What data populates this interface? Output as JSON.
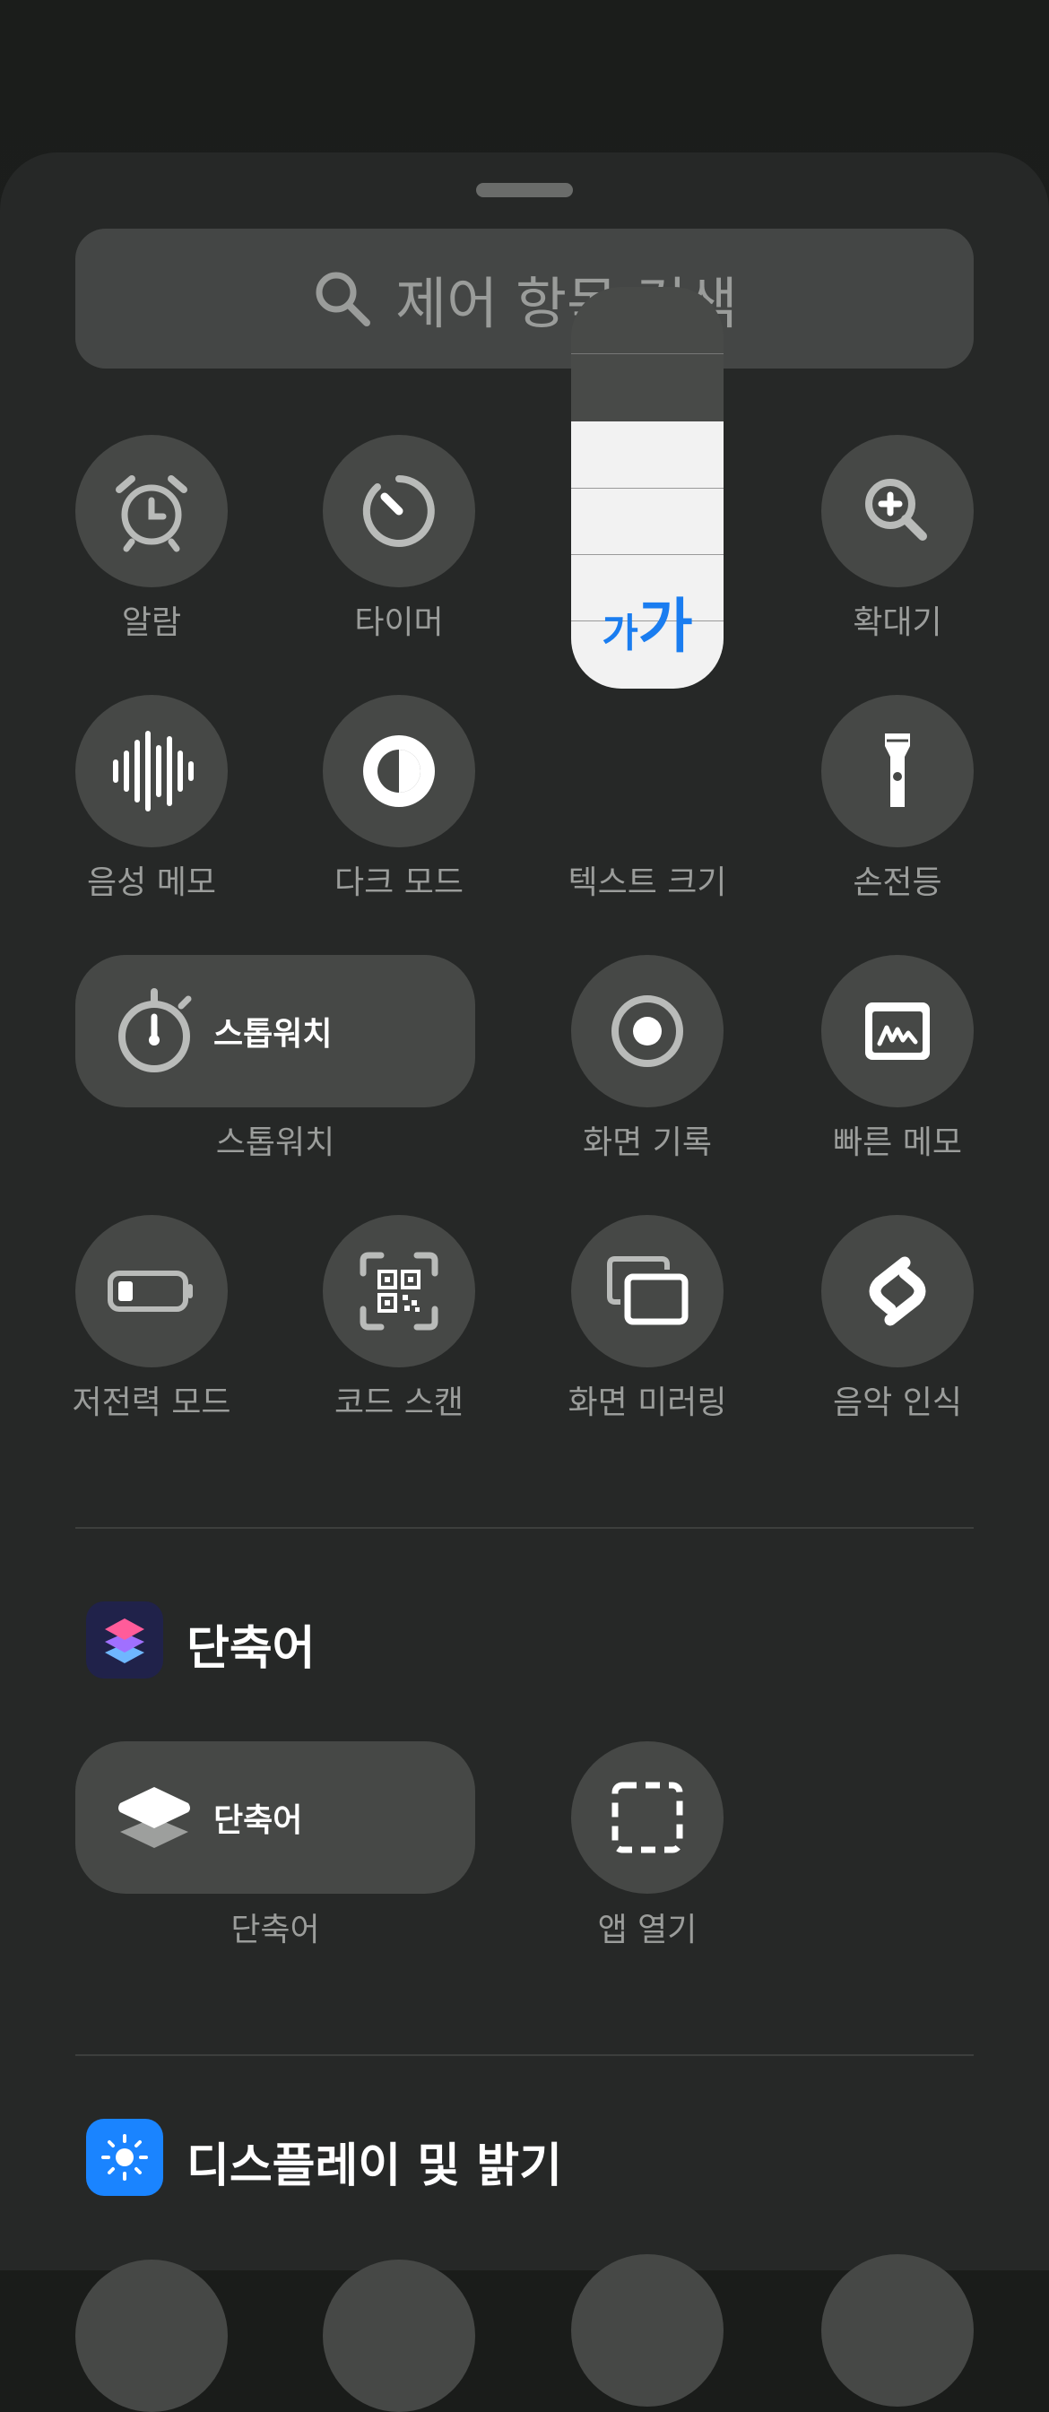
{
  "search": {
    "placeholder": "제어 항목 검색",
    "icon": "search-icon"
  },
  "controls": {
    "alarm": {
      "label": "알람",
      "icon": "alarm-clock-icon"
    },
    "timer": {
      "label": "타이머",
      "icon": "timer-icon"
    },
    "text_size": {
      "label": "텍스트 크기",
      "glyph_small": "가",
      "glyph_big": "가",
      "level_fraction": 0.66,
      "accent": "#1a7df0"
    },
    "magnifier": {
      "label": "확대기",
      "icon": "magnifier-icon"
    },
    "voice_memo": {
      "label": "음성 메모",
      "icon": "waveform-icon"
    },
    "dark_mode": {
      "label": "다크 모드",
      "icon": "dark-mode-icon"
    },
    "flashlight": {
      "label": "손전등",
      "icon": "flashlight-icon"
    },
    "stopwatch": {
      "label": "스톱워치",
      "tile_label": "스톱워치",
      "icon": "stopwatch-icon"
    },
    "screen_record": {
      "label": "화면 기록",
      "icon": "record-icon"
    },
    "quick_note": {
      "label": "빠른 메모",
      "icon": "quick-note-icon"
    },
    "low_power": {
      "label": "저전력 모드",
      "icon": "battery-icon"
    },
    "code_scan": {
      "label": "코드 스캔",
      "icon": "qr-code-icon"
    },
    "screen_mirror": {
      "label": "화면 미러링",
      "icon": "screen-mirroring-icon"
    },
    "music_recognition": {
      "label": "음악 인식",
      "icon": "shazam-icon"
    }
  },
  "sections": {
    "shortcuts": {
      "title": "단축어",
      "icon": "shortcuts-app-icon",
      "items": {
        "shortcut": {
          "label": "단축어",
          "tile_label": "단축어",
          "icon": "shortcuts-layers-icon"
        },
        "open_app": {
          "label": "앱 열기",
          "icon": "open-app-dashed-icon"
        }
      }
    },
    "display": {
      "title": "디스플레이 및 밝기",
      "icon": "sun-icon",
      "accent": "#1a84ff"
    }
  }
}
